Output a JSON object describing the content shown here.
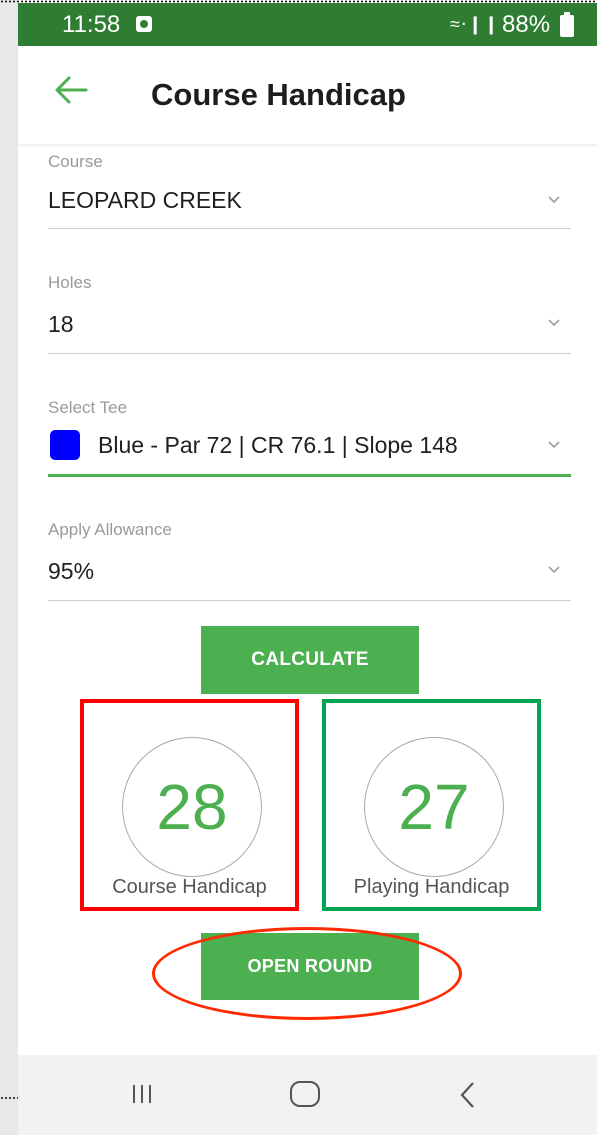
{
  "status_bar": {
    "time": "11:58",
    "battery": "88%",
    "background_color": "#2f7d32"
  },
  "header": {
    "back_icon": "arrow-left-icon",
    "title": "Course Handicap"
  },
  "form": {
    "course": {
      "label": "Course",
      "value": "LEOPARD CREEK"
    },
    "holes": {
      "label": "Holes",
      "value": "18"
    },
    "tee": {
      "label": "Select Tee",
      "value": "Blue - Par 72 | CR 76.1 | Slope 148",
      "swatch_color": "#0000ff"
    },
    "allowance": {
      "label": "Apply Allowance",
      "value": "95%"
    }
  },
  "buttons": {
    "calculate": "CALCULATE",
    "open_round": "OPEN ROUND"
  },
  "results": {
    "course_handicap": {
      "value": "28",
      "label": "Course Handicap"
    },
    "playing_handicap": {
      "value": "27",
      "label": "Playing Handicap"
    }
  },
  "colors": {
    "accent": "#4caf50",
    "highlight_red": "#ff0000",
    "highlight_green": "#00a651",
    "highlight_orange": "#ff2a00"
  }
}
